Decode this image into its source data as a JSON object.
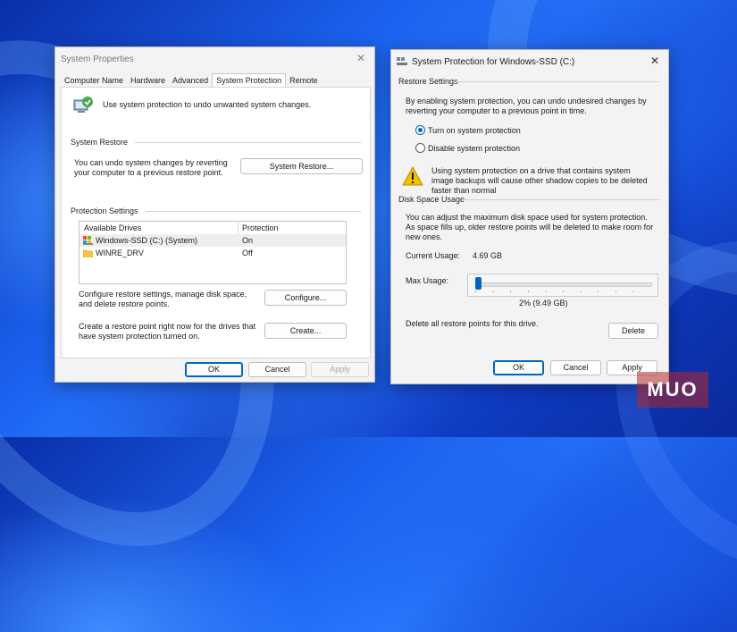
{
  "sysprops": {
    "title": "System Properties",
    "tabs": [
      "Computer Name",
      "Hardware",
      "Advanced",
      "System Protection",
      "Remote"
    ],
    "active_tab": "System Protection",
    "intro": "Use system protection to undo unwanted system changes.",
    "restore": {
      "title": "System Restore",
      "text": "You can undo system changes by reverting your computer to a previous restore point.",
      "button": "System Restore..."
    },
    "protection": {
      "title": "Protection Settings",
      "columns": [
        "Available Drives",
        "Protection"
      ],
      "drives": [
        {
          "name": "Windows-SSD (C:) (System)",
          "protection": "On",
          "icon": "drive-icon"
        },
        {
          "name": "WINRE_DRV",
          "protection": "Off",
          "icon": "folder-icon"
        }
      ],
      "configure_text": "Configure restore settings, manage disk space, and delete restore points.",
      "configure_button": "Configure...",
      "create_text": "Create a restore point right now for the drives that have system protection turned on.",
      "create_button": "Create..."
    },
    "buttons": {
      "ok": "OK",
      "cancel": "Cancel",
      "apply": "Apply"
    }
  },
  "sysprot": {
    "title": "System Protection for Windows-SSD (C:)",
    "restore_settings": {
      "title": "Restore Settings",
      "text": "By enabling system protection, you can undo undesired changes by reverting your computer to a previous point in time.",
      "options": [
        "Turn on system protection",
        "Disable system protection"
      ],
      "selected": "Turn on system protection",
      "warning": "Using system protection on a drive that contains system image backups will cause other shadow copies to be deleted faster than normal"
    },
    "disk_space": {
      "title": "Disk Space Usage",
      "text": "You can adjust the maximum disk space used for system protection. As space fills up, older restore points will be deleted to make room for new ones.",
      "current_label": "Current Usage:",
      "current_value": "4.69 GB",
      "max_label": "Max Usage:",
      "max_value": "2% (9.49 GB)",
      "max_percent": 2,
      "delete_text": "Delete all restore points for this drive.",
      "delete_button": "Delete"
    },
    "buttons": {
      "ok": "OK",
      "cancel": "Cancel",
      "apply": "Apply"
    }
  },
  "watermark": "MUO",
  "colors": {
    "accent": "#0067c0",
    "warning": "#f2c200",
    "wallpaper": "#1c63f0"
  }
}
